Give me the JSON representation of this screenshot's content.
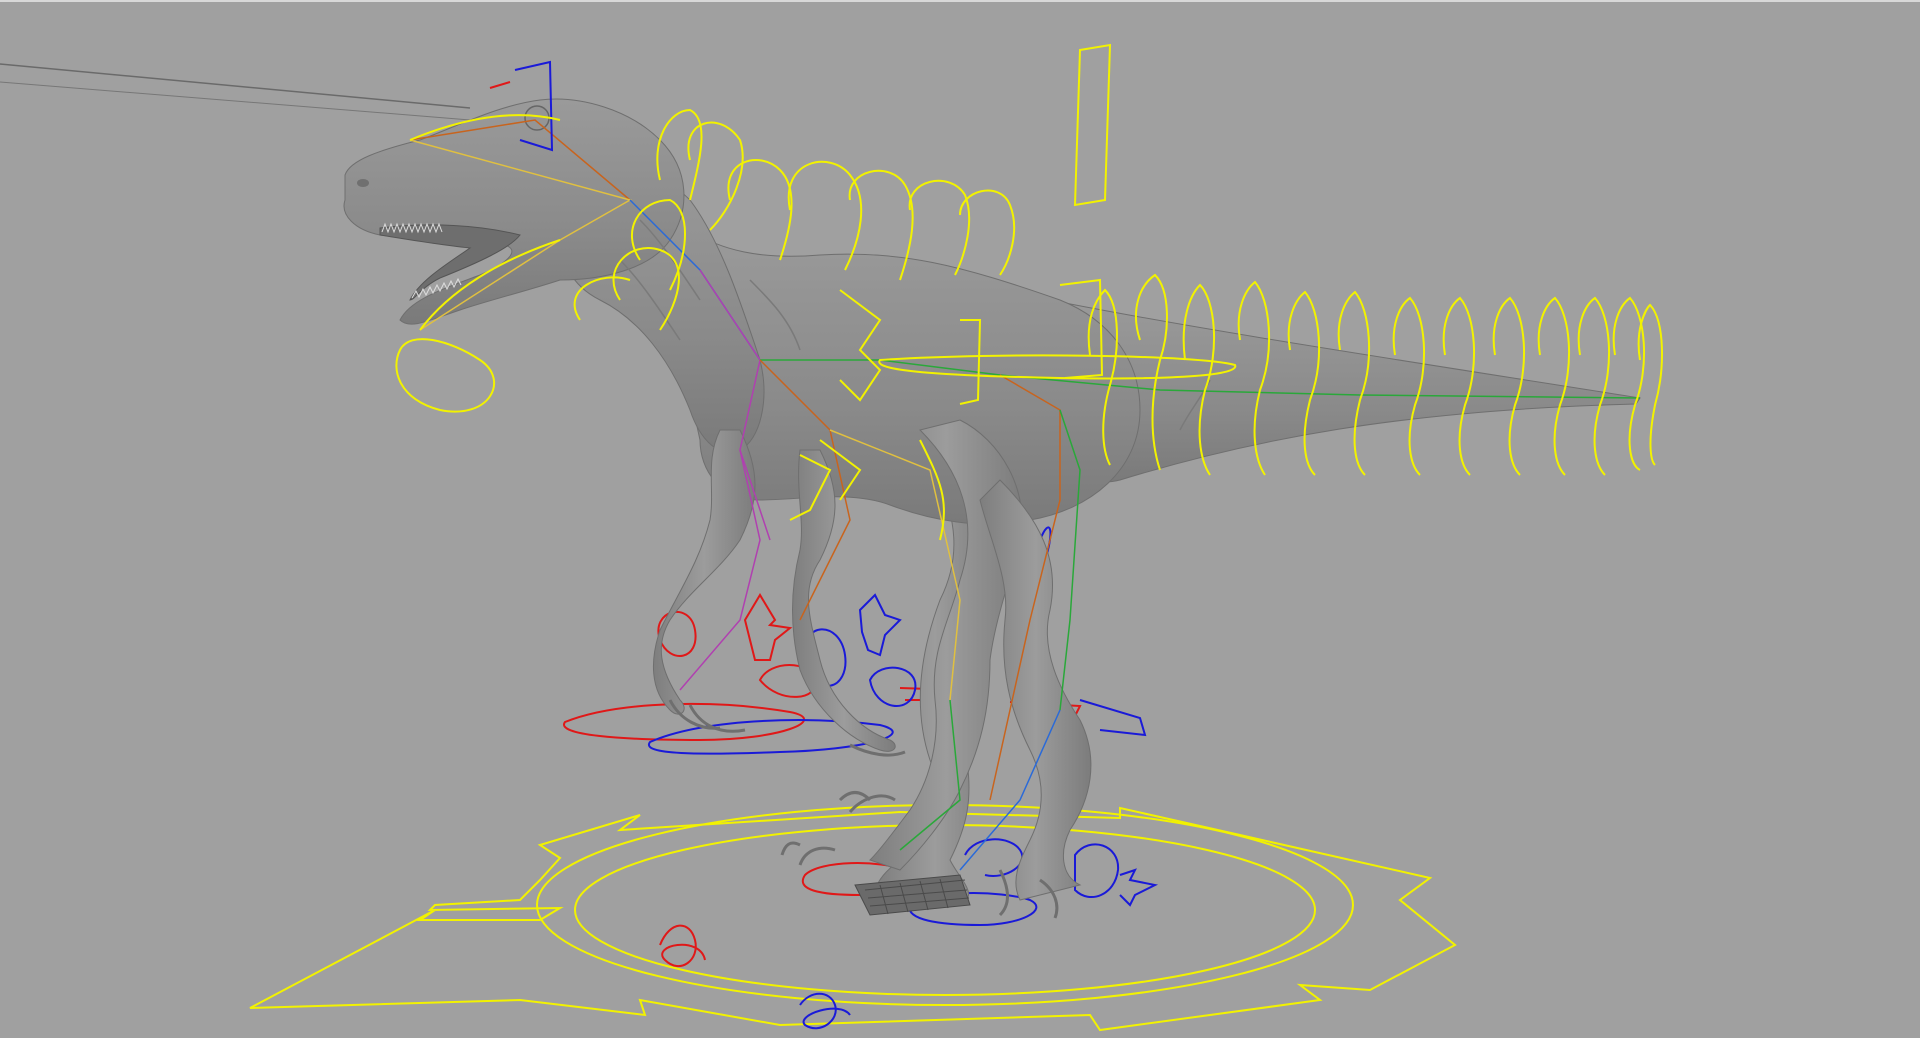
{
  "viewport": {
    "background": "#a0a0a0",
    "mesh_color": "#8f8f8f",
    "mesh_shadow": "#6f6f6f",
    "control_colors": {
      "primary": "#f2f200",
      "left": "#e01818",
      "right": "#1a1ad8"
    },
    "joint_colors": [
      "#c8641e",
      "#2aa83a",
      "#2a6ad8",
      "#b040b0",
      "#e0c040"
    ]
  },
  "scene": {
    "character": "raptor-mesh",
    "rig_controls": [
      "global-ring-control",
      "tail-fk-controls",
      "spine-fk-controls",
      "neck-controls",
      "head-control",
      "left-arm-ik-controls",
      "right-arm-ik-controls",
      "left-foot-ik-controls",
      "right-foot-ik-controls",
      "pole-vector-arrows"
    ]
  }
}
